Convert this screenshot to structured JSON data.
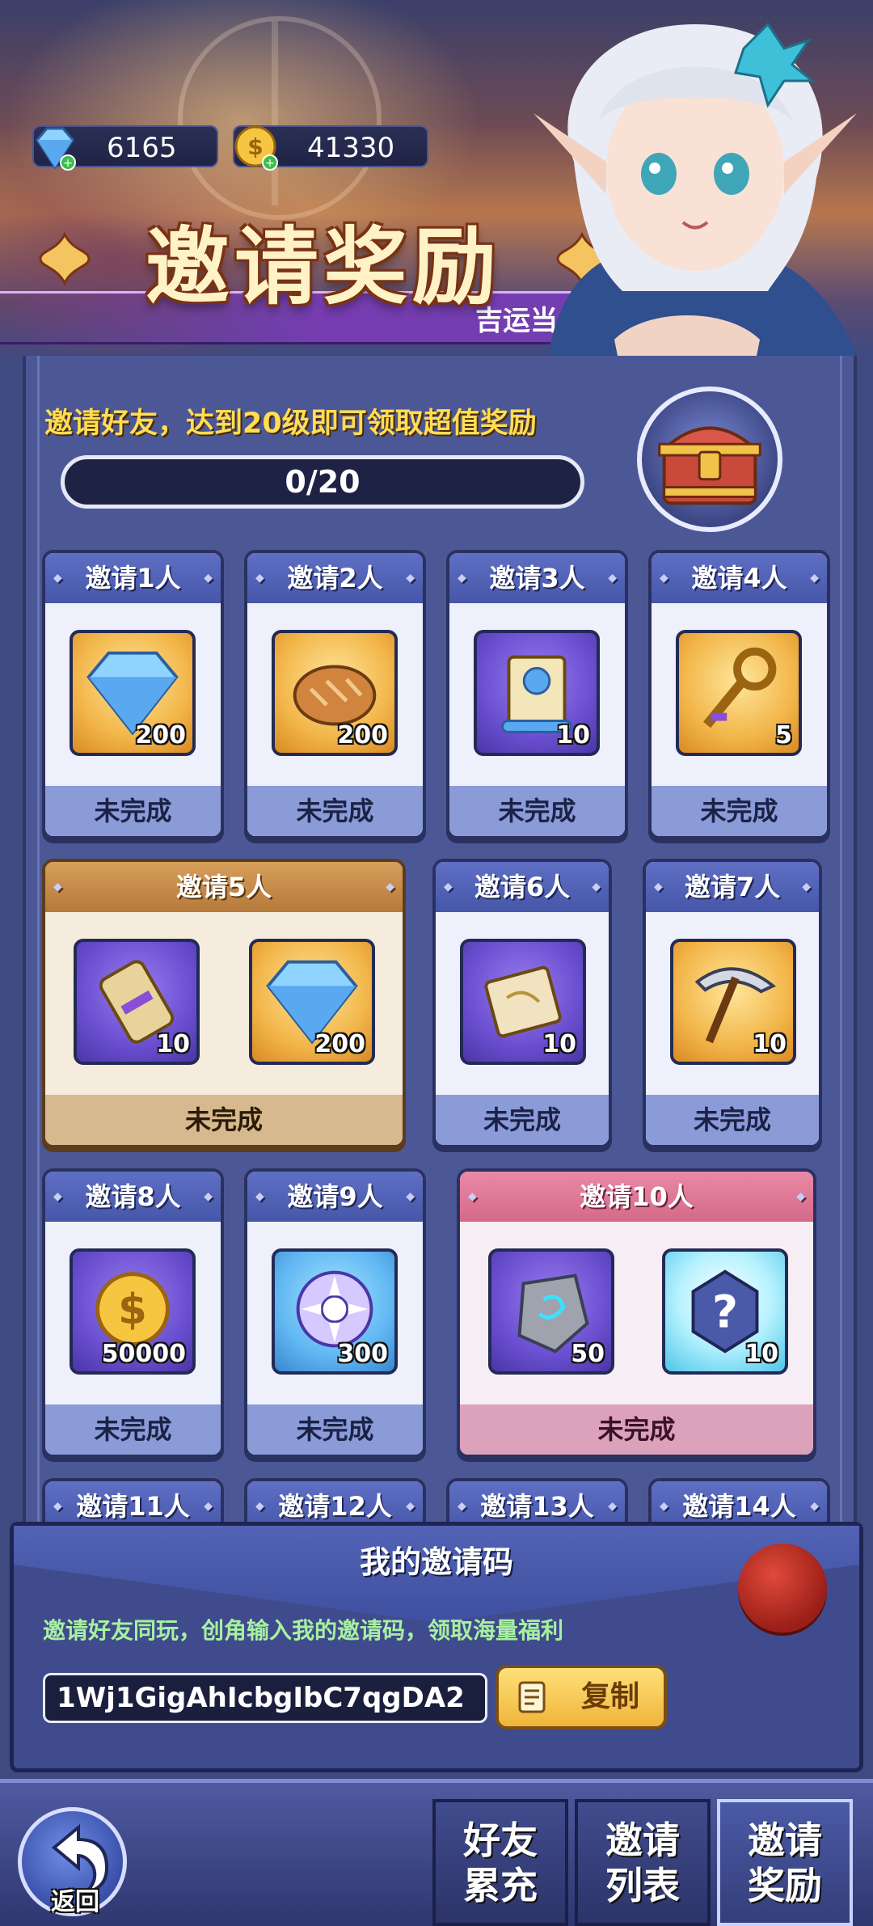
{
  "resources": {
    "diamonds": "6165",
    "coins": "41330"
  },
  "header": {
    "title": "邀请奖励",
    "subtitle": "吉运当头！领主大"
  },
  "invite": {
    "description": "邀请好友，达到20级即可领取超值奖励",
    "progress_text": "0/20",
    "progress_value": 0,
    "progress_max": 20
  },
  "cards": [
    {
      "title": "邀请1人",
      "status": "未完成",
      "items": [
        {
          "icon": "diamond-icon",
          "qty": "200"
        }
      ]
    },
    {
      "title": "邀请2人",
      "status": "未完成",
      "items": [
        {
          "icon": "bread-icon",
          "qty": "200"
        }
      ]
    },
    {
      "title": "邀请3人",
      "status": "未完成",
      "items": [
        {
          "icon": "scroll-icon",
          "qty": "10"
        }
      ]
    },
    {
      "title": "邀请4人",
      "status": "未完成",
      "items": [
        {
          "icon": "key-icon",
          "qty": "5"
        }
      ]
    },
    {
      "title": "邀请5人",
      "status": "未完成",
      "items": [
        {
          "icon": "parchment-roll-icon",
          "qty": "10"
        },
        {
          "icon": "diamond-icon",
          "qty": "200"
        }
      ]
    },
    {
      "title": "邀请6人",
      "status": "未完成",
      "items": [
        {
          "icon": "map-scroll-icon",
          "qty": "10"
        }
      ]
    },
    {
      "title": "邀请7人",
      "status": "未完成",
      "items": [
        {
          "icon": "pickaxe-icon",
          "qty": "10"
        }
      ]
    },
    {
      "title": "邀请8人",
      "status": "未完成",
      "items": [
        {
          "icon": "coin-icon",
          "qty": "50000"
        }
      ]
    },
    {
      "title": "邀请9人",
      "status": "未完成",
      "items": [
        {
          "icon": "saw-blade-icon",
          "qty": "300"
        }
      ]
    },
    {
      "title": "邀请10人",
      "status": "未完成",
      "items": [
        {
          "icon": "rune-stone-icon",
          "qty": "50"
        },
        {
          "icon": "mystery-box-icon",
          "qty": "10"
        }
      ]
    },
    {
      "title": "邀请11人"
    },
    {
      "title": "邀请12人"
    },
    {
      "title": "邀请13人"
    },
    {
      "title": "邀请14人"
    }
  ],
  "invite_code": {
    "title": "我的邀请码",
    "description": "邀请好友同玩，创角输入我的邀请码，领取海量福利",
    "code": "1Wj1GigAhIcbgIbC7qgDA2",
    "copy_label": "复制"
  },
  "nav": {
    "back_label": "返回",
    "tabs": [
      "好友\n累充",
      "邀请\n列表",
      "邀请\n奖励"
    ],
    "active_tab": 2
  },
  "colors": {
    "panel": "#4c5896",
    "progress_track": "#1e2244",
    "card_header": "#4656a8",
    "gold_card_header": "#b57a3a",
    "pink_card_header": "#d46988",
    "title_text": "#fff2c6",
    "desc_text": "#ffdd55",
    "code_desc_text": "#a7f0a0"
  }
}
